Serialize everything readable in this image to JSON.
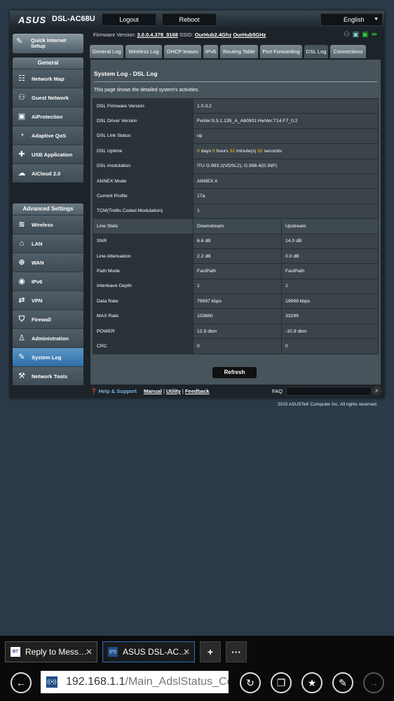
{
  "header": {
    "brand": "ASUS",
    "model": "DSL-AC68U",
    "logout": "Logout",
    "reboot": "Reboot",
    "language": "English",
    "firmware_label": "Firmware Version:",
    "firmware_value": "3.0.0.4.378_9168",
    "ssid_label": "SSID:",
    "ssid_1": "OurHub2.4Ghz",
    "ssid_2": "OurHub5GHz"
  },
  "sidebar": {
    "quick_setup": "Quick Internet Setup",
    "general_title": "General",
    "general_items": [
      {
        "label": "Network Map",
        "icon": "network-map-icon"
      },
      {
        "label": "Guest Network",
        "icon": "guest-network-icon"
      },
      {
        "label": "AiProtection",
        "icon": "lock-icon"
      },
      {
        "label": "Adaptive QoS",
        "icon": "qos-icon"
      },
      {
        "label": "USB Application",
        "icon": "puzzle-icon"
      },
      {
        "label": "AiCloud 2.0",
        "icon": "cloud-icon"
      }
    ],
    "advanced_title": "Advanced Settings",
    "advanced_items": [
      {
        "label": "Wireless",
        "icon": "wifi-icon"
      },
      {
        "label": "LAN",
        "icon": "home-icon"
      },
      {
        "label": "WAN",
        "icon": "globe-icon"
      },
      {
        "label": "IPv6",
        "icon": "ipv6-icon"
      },
      {
        "label": "VPN",
        "icon": "vpn-icon"
      },
      {
        "label": "Firewall",
        "icon": "shield-icon"
      },
      {
        "label": "Administration",
        "icon": "admin-icon"
      },
      {
        "label": "System Log",
        "icon": "log-icon"
      },
      {
        "label": "Network Tools",
        "icon": "tools-icon"
      }
    ],
    "active": "System Log"
  },
  "tabs": [
    "General Log",
    "Wireless Log",
    "DHCP leases",
    "IPv6",
    "Routing Table",
    "Port Forwarding",
    "DSL Log",
    "Connections"
  ],
  "active_tab": "DSL Log",
  "page": {
    "title": "System Log - DSL Log",
    "description": "This page shows the detailed system's activities.",
    "info_rows": [
      {
        "key": "DSL Firmware Version",
        "value": "1.0.3.2"
      },
      {
        "key": "DSL Driver Version",
        "value": "FwVer:5.5.1.135_A_A60901 HwVer:T14.F7_0.2"
      },
      {
        "key": "DSL Link Status",
        "value": "up"
      },
      {
        "key": "DSL modulation",
        "value": "ITU G.993.2(VDSL2), G.998.4(G.INP)"
      },
      {
        "key": "ANNEX Mode",
        "value": "ANNEX A"
      },
      {
        "key": "Current Profile",
        "value": "17a"
      },
      {
        "key": "TCM(Trellis Coded Modulation)",
        "value": "1"
      }
    ],
    "uptime": {
      "key": "DSL Uptime",
      "days": "0",
      "days_label": "days",
      "hours": "0",
      "hours_label": "hours",
      "minutes": "32",
      "minutes_label": "minute(s)",
      "seconds": "32",
      "seconds_label": "seconds"
    },
    "line_header": {
      "key": "Line Stats",
      "down": "Downstream",
      "up": "Upstream"
    },
    "line_rows": [
      {
        "key": "SNR",
        "down": "6.6 dB",
        "up": "14.0 dB"
      },
      {
        "key": "Line Attenuation",
        "down": "2.2 dB",
        "up": "0.0 dB"
      },
      {
        "key": "Path Mode",
        "down": "FastPath",
        "up": "FastPath"
      },
      {
        "key": "Interleave Depth",
        "down": "1",
        "up": "1"
      },
      {
        "key": "Data Rate",
        "down": "79997 kbps",
        "up": "19999 kbps"
      },
      {
        "key": "MAX Rate",
        "down": "103660",
        "up": "33299"
      },
      {
        "key": "POWER",
        "down": "12.9 dbm",
        "up": "-10.9 dbm"
      },
      {
        "key": "CRC",
        "down": "0",
        "up": "0"
      }
    ],
    "refresh": "Refresh"
  },
  "footer": {
    "help": "Help & Support",
    "manual": "Manual",
    "utility": "Utility",
    "feedback": "Feedback",
    "sep": "|",
    "faq": "FAQ",
    "copyright": "2015 ASUSTeK Computer Inc. All rights reserved."
  },
  "browser": {
    "tabs": [
      {
        "title": "Reply to Mess…",
        "favicon": "BT"
      },
      {
        "title": "ASUS DSL-AC…",
        "favicon": "((•))"
      }
    ],
    "new_tab": "+",
    "more": "···",
    "url_host": "192.168.1.1",
    "url_path": "/Main_AdslStatus_Content.asp",
    "url_favicon": "((•))"
  }
}
